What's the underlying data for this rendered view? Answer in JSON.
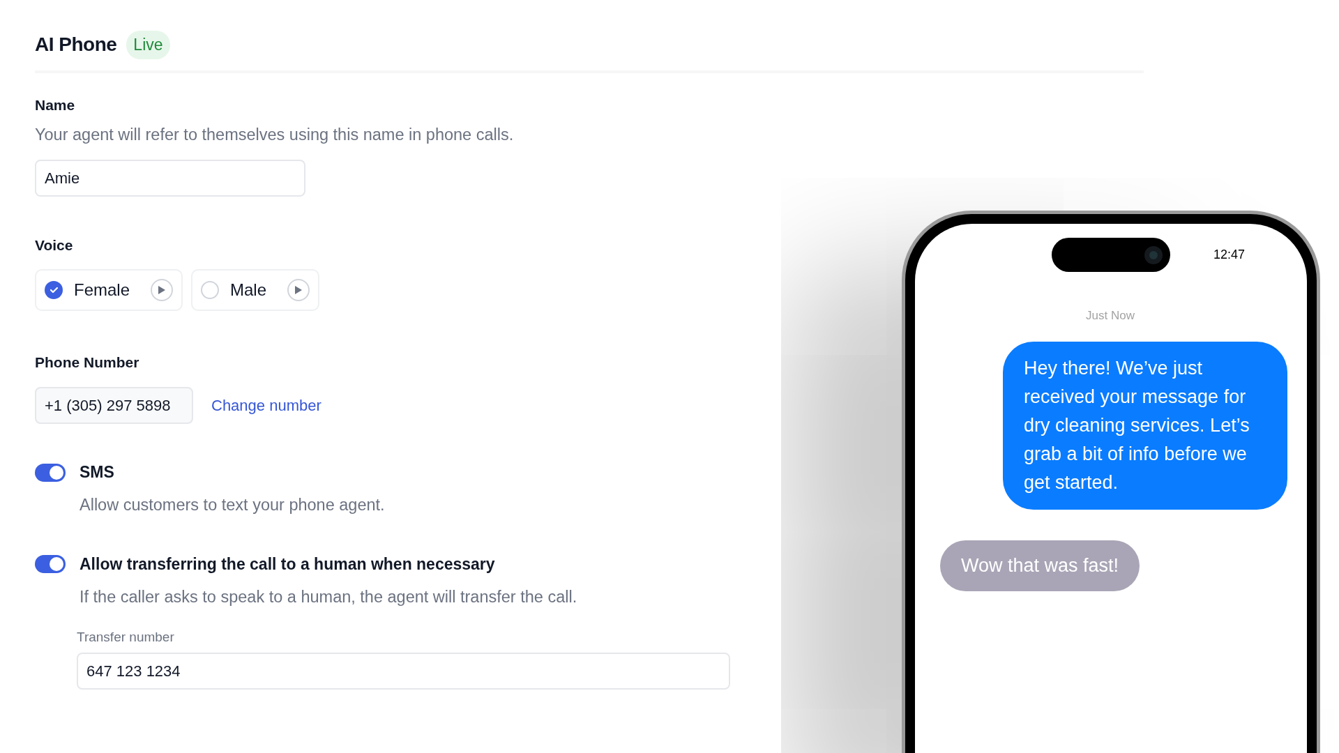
{
  "header": {
    "title": "AI Phone",
    "badge": "Live"
  },
  "name": {
    "label": "Name",
    "description": "Your agent will refer to themselves using this name in phone calls.",
    "value": "Amie"
  },
  "voice": {
    "label": "Voice",
    "options": [
      {
        "label": "Female",
        "selected": true
      },
      {
        "label": "Male",
        "selected": false
      }
    ]
  },
  "phone_number": {
    "label": "Phone Number",
    "value": "+1 (305) 297 5898",
    "link": "Change number"
  },
  "toggles": [
    {
      "title": "SMS",
      "description": "Allow customers to text your phone agent.",
      "on": true
    },
    {
      "title": "Allow transferring the call to a human when necessary",
      "description": "If the caller asks to speak to a human, the agent will transfer the call.",
      "on": true,
      "field": {
        "label": "Transfer number",
        "value": "647 123 1234"
      }
    }
  ],
  "preview": {
    "time": "12:47",
    "timestamp": "Just Now",
    "messages": [
      {
        "kind": "sent",
        "text": "Hey there! We’ve just received your message for dry cleaning services. Let’s grab a bit of info before we get started."
      },
      {
        "kind": "received",
        "text": "Wow that was fast!"
      }
    ]
  }
}
